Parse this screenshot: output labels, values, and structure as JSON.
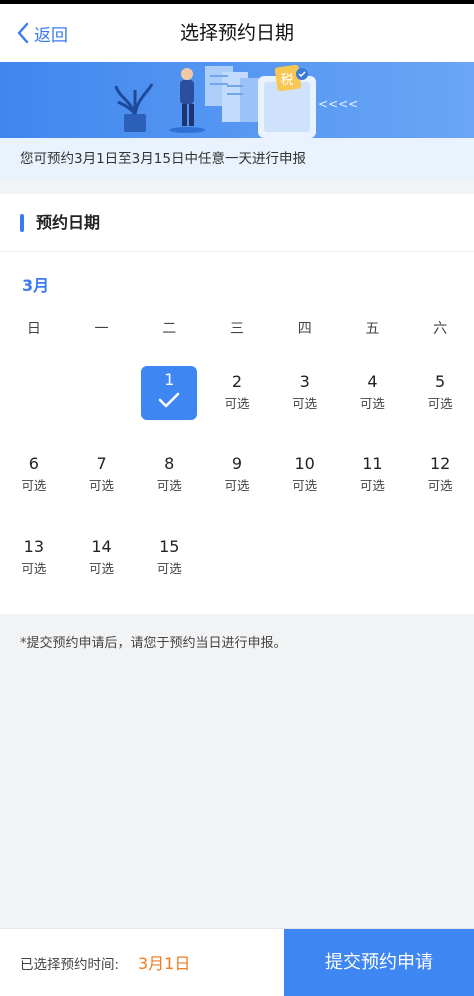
{
  "nav": {
    "back_label": "返回",
    "title": "选择预约日期"
  },
  "banner": {
    "tax_badge": "税",
    "arrows": "<<<<"
  },
  "notice": "您可预约3月1日至3月15日中任意一天进行申报",
  "section_title": "预约日期",
  "calendar": {
    "month": "3月",
    "weekdays": [
      "日",
      "一",
      "二",
      "三",
      "四",
      "五",
      "六"
    ],
    "days": [
      {
        "num": "1",
        "status": "selected"
      },
      {
        "num": "2",
        "status": "可选"
      },
      {
        "num": "3",
        "status": "可选"
      },
      {
        "num": "4",
        "status": "可选"
      },
      {
        "num": "5",
        "status": "可选"
      },
      {
        "num": "6",
        "status": "可选"
      },
      {
        "num": "7",
        "status": "可选"
      },
      {
        "num": "8",
        "status": "可选"
      },
      {
        "num": "9",
        "status": "可选"
      },
      {
        "num": "10",
        "status": "可选"
      },
      {
        "num": "11",
        "status": "可选"
      },
      {
        "num": "12",
        "status": "可选"
      },
      {
        "num": "13",
        "status": "可选"
      },
      {
        "num": "14",
        "status": "可选"
      },
      {
        "num": "15",
        "status": "可选"
      }
    ]
  },
  "footnote": "*提交预约申请后，请您于预约当日进行申报。",
  "bottom": {
    "selected_label": "已选择预约时间:",
    "selected_value": "3月1日",
    "submit_label": "提交预约申请"
  },
  "colors": {
    "accent": "#3e86f2",
    "highlight": "#f07a1e"
  }
}
